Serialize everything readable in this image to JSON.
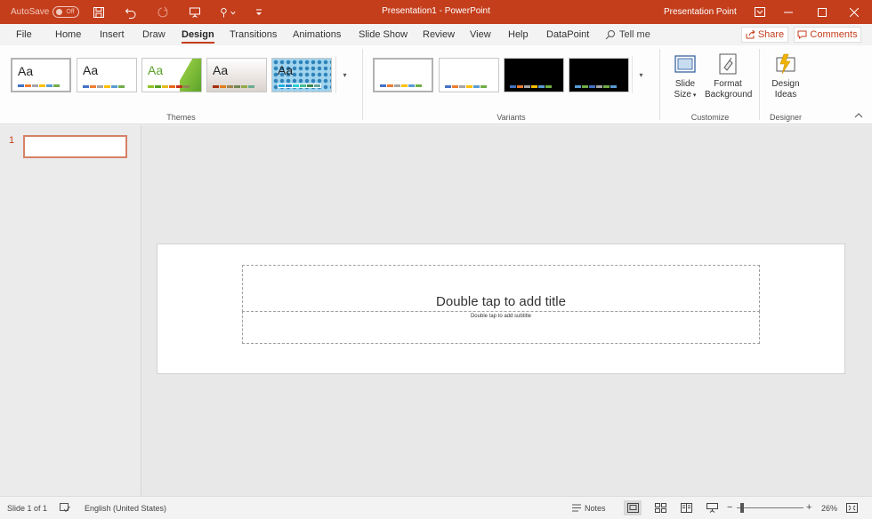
{
  "window": {
    "autosave_label": "AutoSave",
    "autosave_state": "Off",
    "title": "Presentation1  -  PowerPoint",
    "user": "Presentation Point"
  },
  "tabs": [
    "File",
    "Home",
    "Insert",
    "Draw",
    "Design",
    "Transitions",
    "Animations",
    "Slide Show",
    "Review",
    "View",
    "Help",
    "DataPoint"
  ],
  "active_tab": "Design",
  "tell_me": "Tell me",
  "share_label": "Share",
  "comments_label": "Comments",
  "ribbon": {
    "themes": [
      "Aa",
      "Aa",
      "Aa",
      "Aa",
      "Aa"
    ],
    "themes_label": "Themes",
    "variants_label": "Variants",
    "slide_size": [
      "Slide",
      "Size"
    ],
    "format_background": [
      "Format",
      "Background"
    ],
    "customize_label": "Customize",
    "design_ideas": [
      "Design",
      "Ideas"
    ],
    "designer_label": "Designer"
  },
  "slides": {
    "number": "1"
  },
  "slide": {
    "title_placeholder": "Double tap to add title",
    "subtitle_placeholder": "Double tap to add subtitle"
  },
  "status": {
    "slide_info": "Slide 1 of 1",
    "language": "English (United States)",
    "notes": "Notes",
    "zoom": "26%"
  },
  "colors": {
    "accent": "#c43e1c"
  }
}
